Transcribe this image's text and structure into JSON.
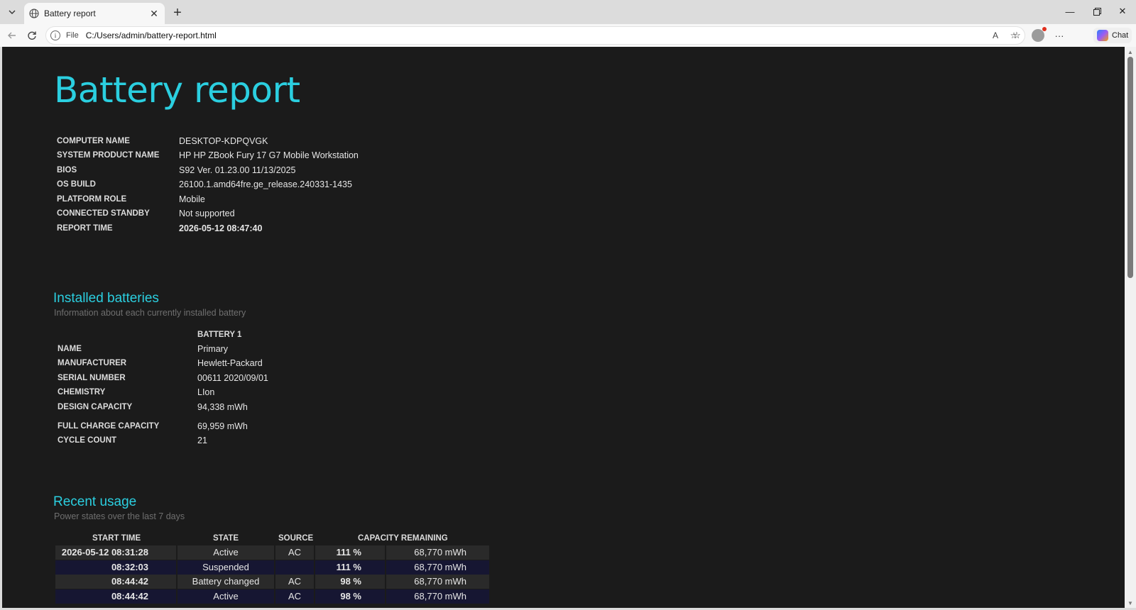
{
  "browser": {
    "tab_title": "Battery report",
    "address_scheme": "File",
    "address_url": "C:/Users/admin/battery-report.html",
    "chat_label": "Chat"
  },
  "report": {
    "title": "Battery report",
    "system_info": [
      {
        "label": "COMPUTER NAME",
        "value": "DESKTOP-KDPQVGK"
      },
      {
        "label": "SYSTEM PRODUCT NAME",
        "value": "HP HP ZBook Fury 17 G7 Mobile Workstation"
      },
      {
        "label": "BIOS",
        "value": "S92 Ver. 01.23.00 11/13/2025"
      },
      {
        "label": "OS BUILD",
        "value": "26100.1.amd64fre.ge_release.240331-1435"
      },
      {
        "label": "PLATFORM ROLE",
        "value": "Mobile"
      },
      {
        "label": "CONNECTED STANDBY",
        "value": "Not supported"
      },
      {
        "label": "REPORT TIME",
        "value": "2026-05-12  08:47:40"
      }
    ],
    "installed": {
      "heading": "Installed batteries",
      "subheading": "Information about each currently installed battery",
      "column": "BATTERY 1",
      "rows": [
        {
          "label": "NAME",
          "value": "Primary"
        },
        {
          "label": "MANUFACTURER",
          "value": "Hewlett-Packard"
        },
        {
          "label": "SERIAL NUMBER",
          "value": "00611 2020/09/01"
        },
        {
          "label": "CHEMISTRY",
          "value": "LIon"
        },
        {
          "label": "DESIGN CAPACITY",
          "value": "94,338 mWh"
        },
        {
          "label": "FULL CHARGE CAPACITY",
          "value": "69,959 mWh"
        },
        {
          "label": "CYCLE COUNT",
          "value": "21"
        }
      ]
    },
    "usage": {
      "heading": "Recent usage",
      "subheading": "Power states over the last 7 days",
      "columns": [
        "START TIME",
        "STATE",
        "SOURCE",
        "CAPACITY REMAINING"
      ],
      "rows": [
        {
          "start": "2026-05-12  08:31:28",
          "state": "Active",
          "source": "AC",
          "percent": "111 %",
          "mwh": "68,770 mWh"
        },
        {
          "start": "08:32:03",
          "state": "Suspended",
          "source": "",
          "percent": "111 %",
          "mwh": "68,770 mWh"
        },
        {
          "start": "08:44:42",
          "state": "Battery changed",
          "source": "AC",
          "percent": "98 %",
          "mwh": "68,770 mWh"
        },
        {
          "start": "08:44:42",
          "state": "Active",
          "source": "AC",
          "percent": "98 %",
          "mwh": "68,770 mWh"
        }
      ]
    }
  }
}
